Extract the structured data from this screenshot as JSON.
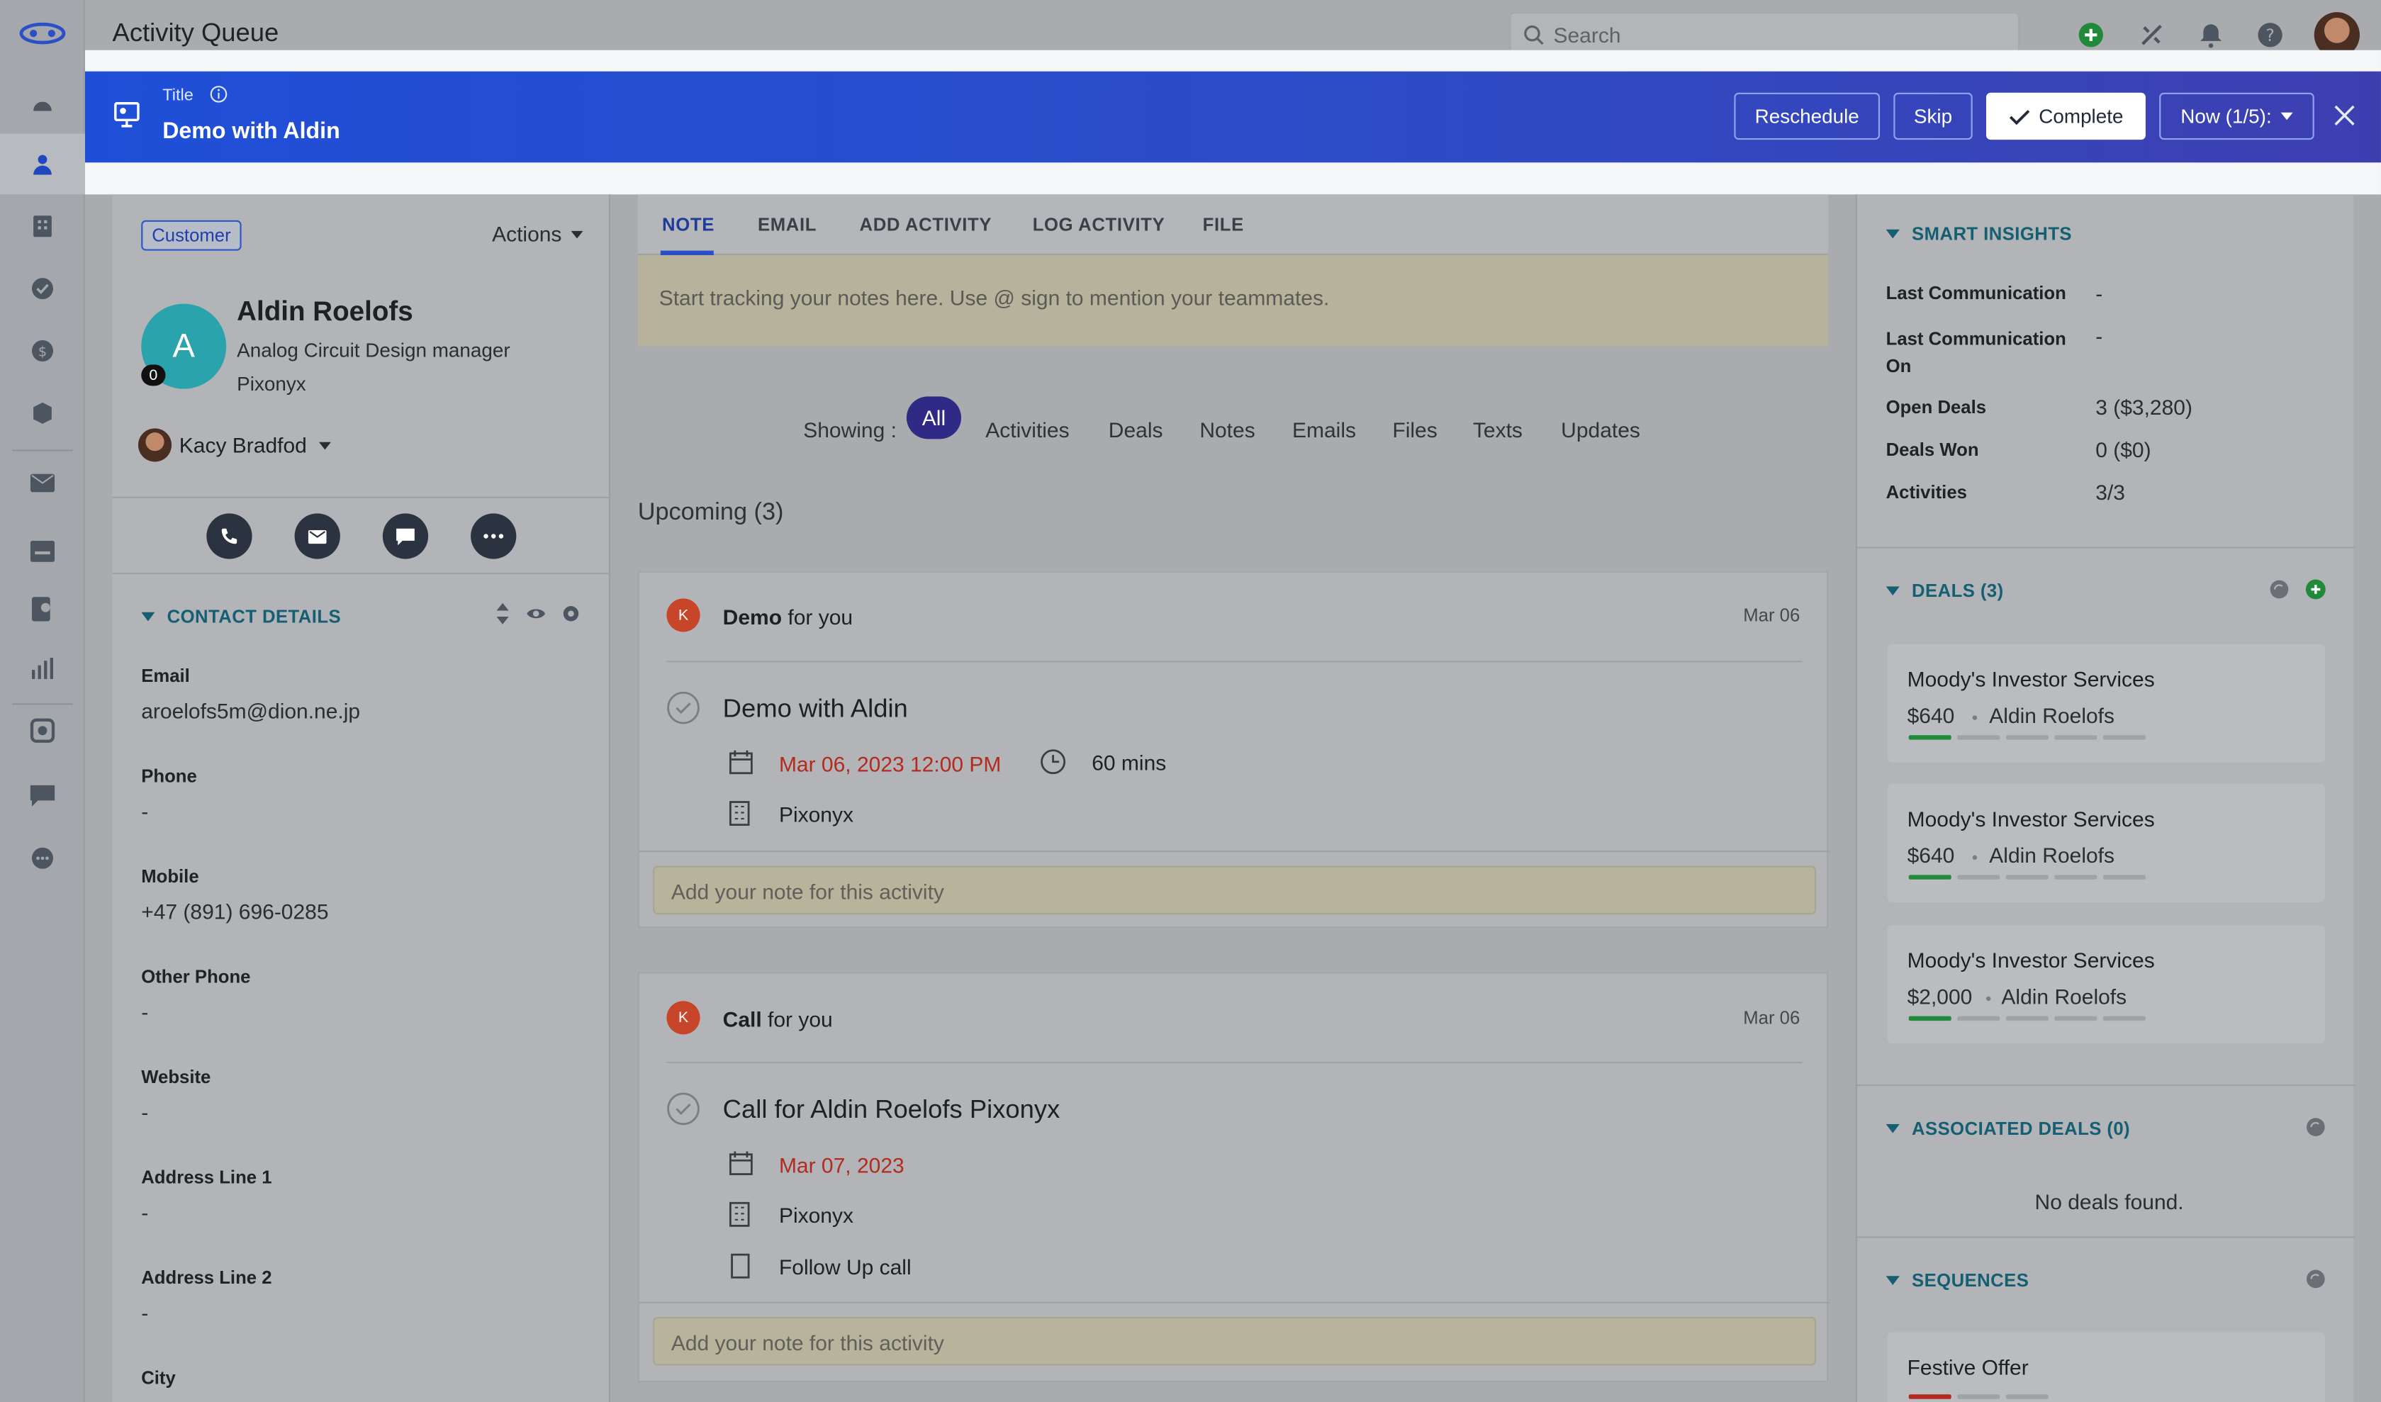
{
  "app": {
    "title": "Activity Queue"
  },
  "search": {
    "placeholder": "Search"
  },
  "banner": {
    "label": "Title",
    "title": "Demo with Aldin",
    "reschedule": "Reschedule",
    "skip": "Skip",
    "complete": "Complete",
    "now": "Now (1/5):"
  },
  "contact": {
    "badge": "Customer",
    "actions": "Actions",
    "initial": "A",
    "count": "0",
    "name": "Aldin Roelofs",
    "role": "Analog Circuit Design manager",
    "company": "Pixonyx",
    "owner": "Kacy Bradfod"
  },
  "details": {
    "section": "CONTACT DETAILS",
    "fields": [
      {
        "label": "Email",
        "value": "aroelofs5m@dion.ne.jp"
      },
      {
        "label": "Phone",
        "value": "-"
      },
      {
        "label": "Mobile",
        "value": "+47 (891) 696-0285"
      },
      {
        "label": "Other Phone",
        "value": "-"
      },
      {
        "label": "Website",
        "value": "-"
      },
      {
        "label": "Address Line 1",
        "value": "-"
      },
      {
        "label": "Address Line 2",
        "value": "-"
      },
      {
        "label": "City",
        "value": ""
      }
    ]
  },
  "tabs": [
    "NOTE",
    "EMAIL",
    "ADD ACTIVITY",
    "LOG ACTIVITY",
    "FILE"
  ],
  "note": {
    "placeholder": "Start tracking your notes here. Use @ sign to mention your teammates."
  },
  "filters": {
    "showing": "Showing :",
    "items": [
      "All",
      "Activities",
      "Deals",
      "Notes",
      "Emails",
      "Files",
      "Texts",
      "Updates"
    ]
  },
  "upcoming": "Upcoming (3)",
  "activities": [
    {
      "avatar": "K",
      "type": "Demo",
      "for": "for you",
      "date": "Mar 06",
      "title": "Demo with Aldin",
      "when": "Mar 06, 2023 12:00 PM",
      "duration": "60 mins",
      "company": "Pixonyx",
      "note_placeholder": "Add your note for this activity"
    },
    {
      "avatar": "K",
      "type": "Call",
      "for": "for you",
      "date": "Mar 06",
      "title": "Call for Aldin Roelofs Pixonyx",
      "when": "Mar 07, 2023",
      "company": "Pixonyx",
      "description": "Follow Up call",
      "note_placeholder": "Add your note for this activity"
    }
  ],
  "insights": {
    "section": "SMART INSIGHTS",
    "rows": [
      {
        "label": "Last Communication",
        "value": "-"
      },
      {
        "label": "Last Communication On",
        "value": "-"
      },
      {
        "label": "Open Deals",
        "value": "3 ($3,280)"
      },
      {
        "label": "Deals Won",
        "value": "0 ($0)"
      },
      {
        "label": "Activities",
        "value": "3/3"
      }
    ]
  },
  "deals": {
    "section": "DEALS (3)",
    "items": [
      {
        "name": "Moody's Investor Services",
        "amount": "$640",
        "contact": "Aldin Roelofs"
      },
      {
        "name": "Moody's Investor Services",
        "amount": "$640",
        "contact": "Aldin Roelofs"
      },
      {
        "name": "Moody's Investor Services",
        "amount": "$2,000",
        "contact": "Aldin Roelofs"
      }
    ]
  },
  "associated": {
    "section": "ASSOCIATED DEALS (0)",
    "empty": "No deals found."
  },
  "sequences": {
    "section": "SEQUENCES",
    "items": [
      {
        "name": "Festive Offer"
      }
    ]
  },
  "colors": {
    "banner": "#1f4fd8",
    "accent": "#155f73",
    "pill": "#2f2a86",
    "danger": "#b32a1f"
  }
}
